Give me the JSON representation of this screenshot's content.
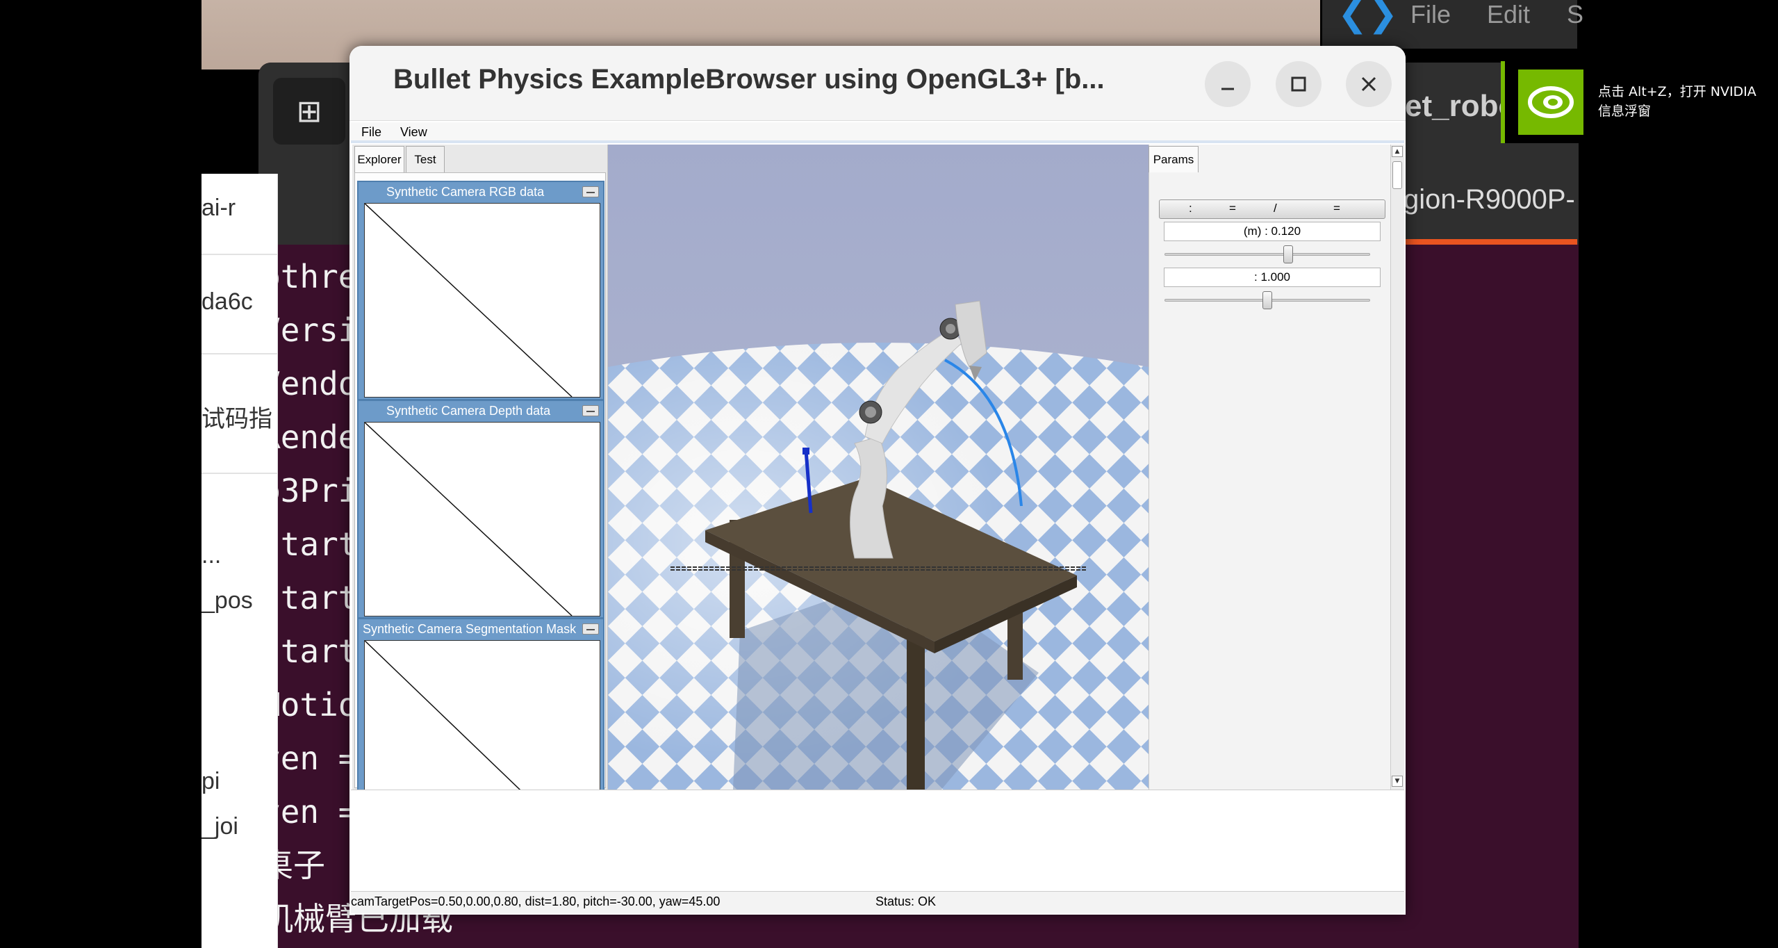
{
  "desktop": {
    "left_panel_lines": [
      "ai-r",
      "da6c",
      "试码指",
      "...",
      "_pos",
      "pi",
      "_joi"
    ]
  },
  "terminal": {
    "lines": [
      "pthre",
      "Versi",
      "Vendo",
      "Rende",
      "b3Pri",
      "start",
      "start",
      "start",
      "Motio",
      "ven =",
      "ven =",
      "桌子",
      "机械臂已加载"
    ]
  },
  "vscode": {
    "menu_file": "File",
    "menu_edit": "Edit",
    "menu_s": "S"
  },
  "right_terminal": {
    "title": "et_robot",
    "host": "gion-R9000P-"
  },
  "nvidia": {
    "toast_text": "点击 Alt+Z，打开 NVIDIA 信息浮窗"
  },
  "window": {
    "title": "Bullet Physics ExampleBrowser using OpenGL3+ [b...",
    "menu": {
      "file": "File",
      "view": "View"
    },
    "tabs": {
      "explorer": "Explorer",
      "test": "Test",
      "params": "Params"
    },
    "camera_panels": [
      {
        "title": "Synthetic Camera RGB data"
      },
      {
        "title": "Synthetic Camera Depth data"
      },
      {
        "title": "Synthetic Camera Segmentation Mask"
      }
    ],
    "params": {
      "header": [
        ":",
        "=",
        "/",
        "="
      ],
      "param1_label": "(m) : 0.120",
      "param1_value": 0.12,
      "param2_label": ": 1.000",
      "param2_value": 1.0
    },
    "status": {
      "camera": "camTargetPos=0.50,0.00,0.80, dist=1.80, pitch=-30.00, yaw=45.00",
      "state": "Status: OK"
    }
  },
  "colors": {
    "terminal_bg": "#3a0f2b",
    "nvidia_green": "#76b900",
    "ubuntu_orange": "#e95420",
    "sky": "#a9b1cf",
    "checker_blue": "#9bb7df",
    "table_top": "#5b4f3e"
  }
}
